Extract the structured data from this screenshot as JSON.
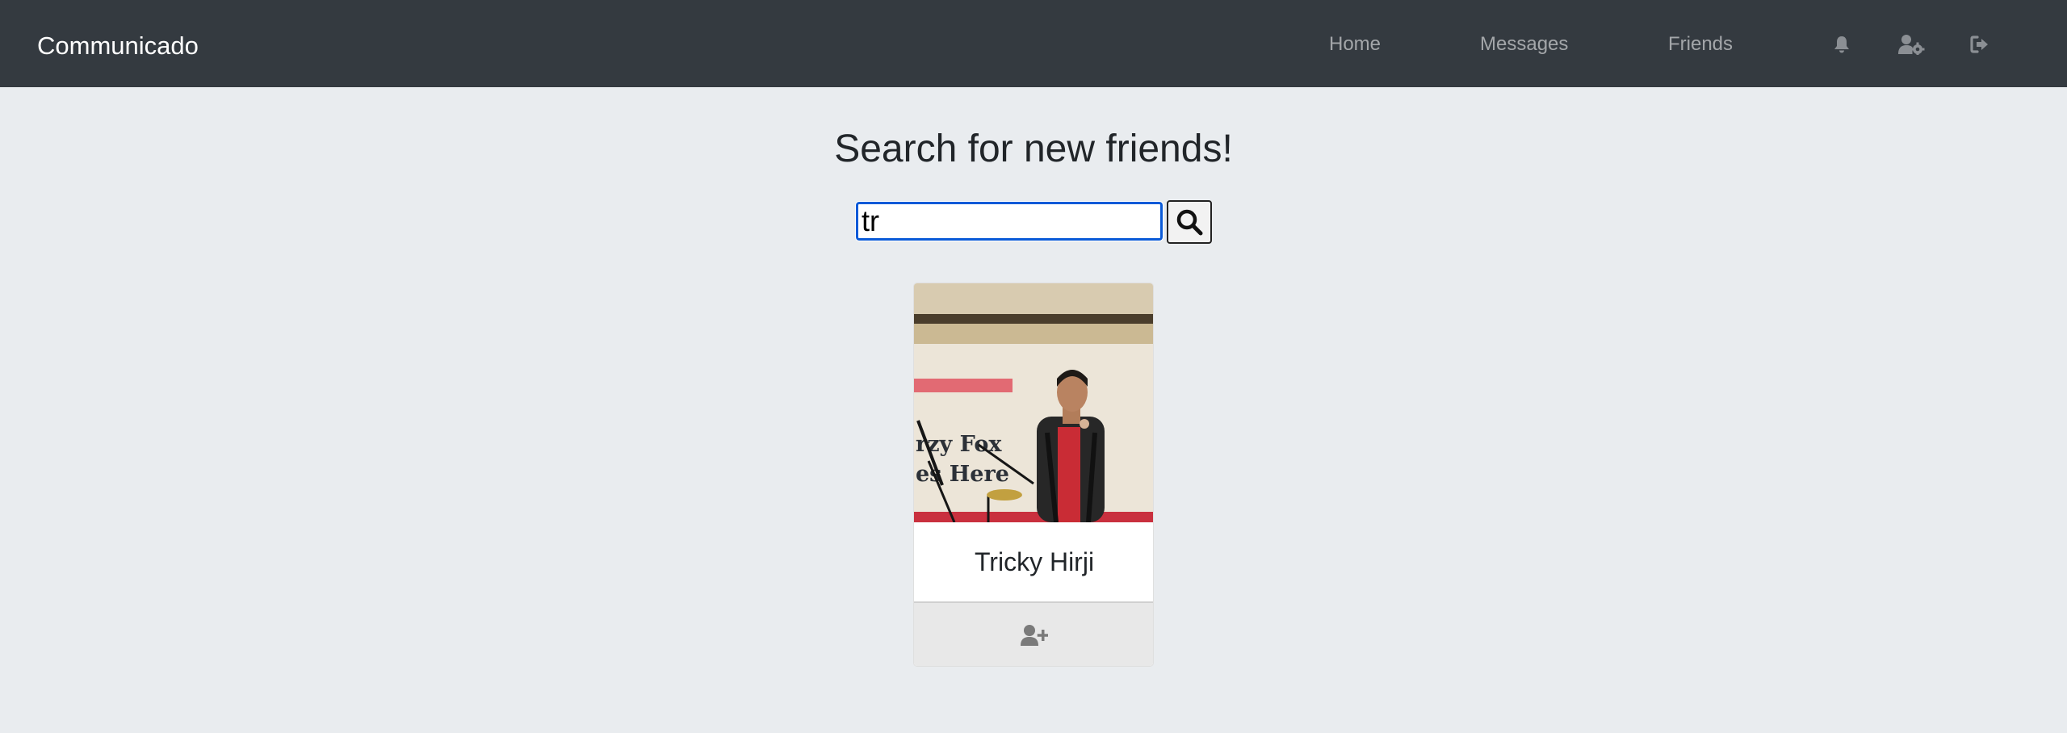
{
  "navbar": {
    "brand": "Communicado",
    "links": [
      "Home",
      "Messages",
      "Friends"
    ],
    "icons": [
      "bell-icon",
      "user-cog-icon",
      "sign-out-icon"
    ],
    "background": "#343a40"
  },
  "search": {
    "heading": "Search for new friends!",
    "query": "tr",
    "button_icon": "search-icon"
  },
  "results": [
    {
      "name": "Tricky Hirji",
      "photo_text": [
        "rzy Fox",
        "es Here"
      ],
      "action_icon": "user-plus-icon"
    }
  ],
  "colors": {
    "page_background": "#e9ecef",
    "focus_border": "#0a5ad8",
    "nav_link": "rgba(255,255,255,0.55)"
  }
}
